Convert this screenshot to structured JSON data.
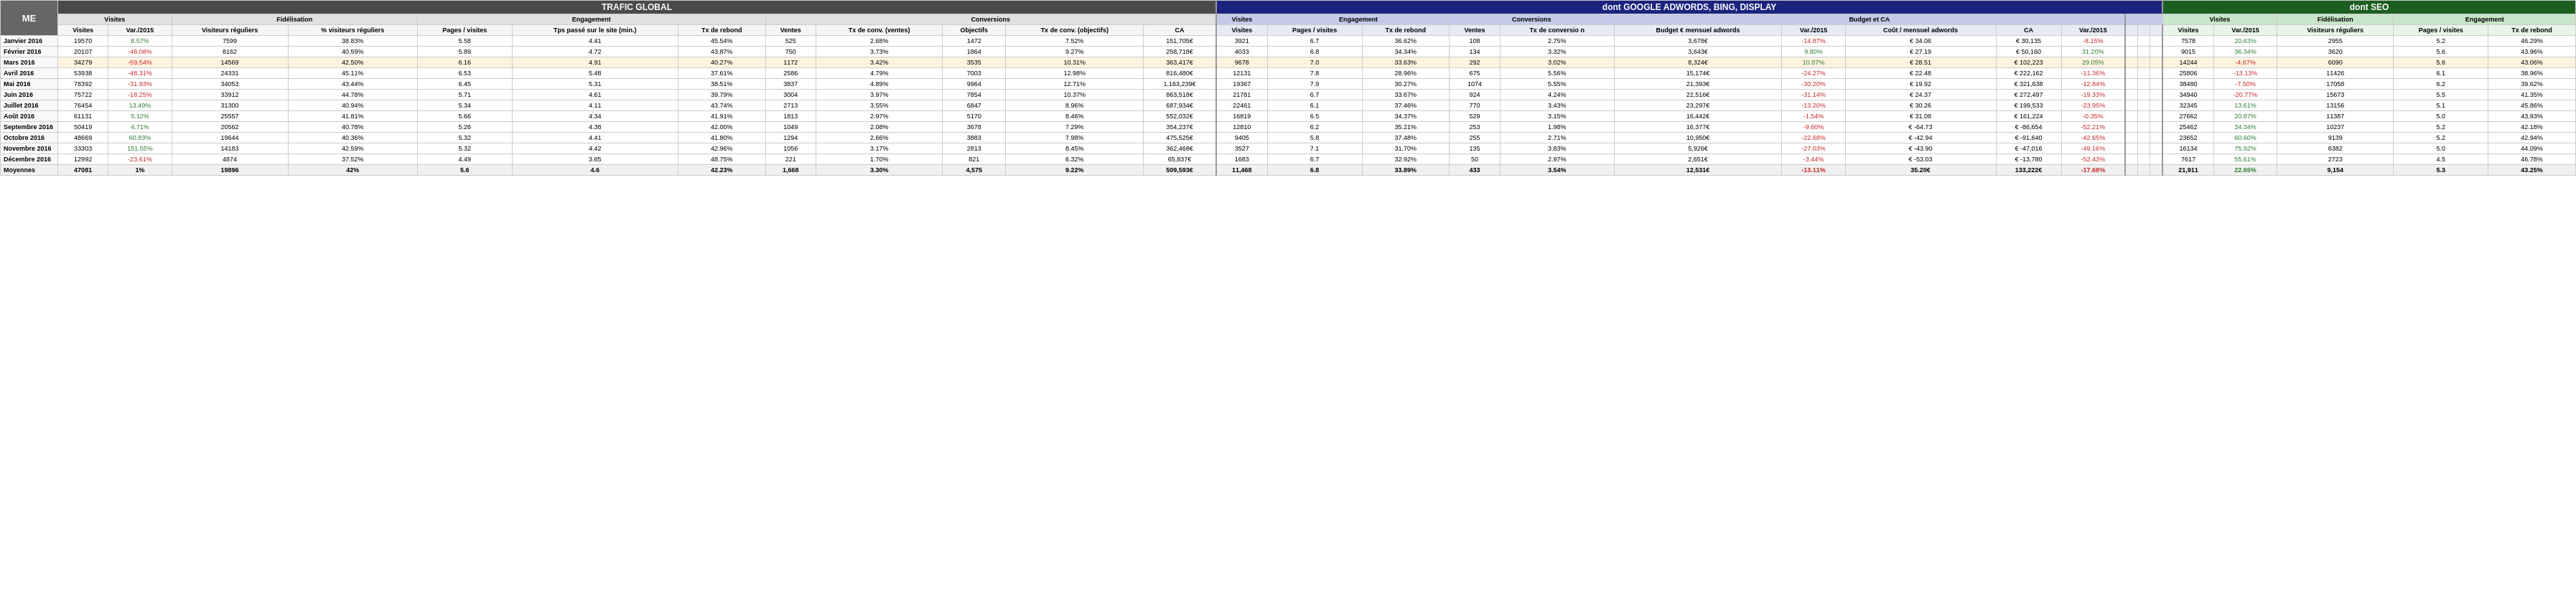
{
  "headers": {
    "me": "ME",
    "trafic_global": "TRAFIC GLOBAL",
    "adwords": "dont GOOGLE ADWORDS, BING, DISPLAY",
    "seo": "dont SEO",
    "visites": "Visites",
    "fidelisation": "Fidélisation",
    "engagement": "Engagement",
    "conversions": "Conversions",
    "budget_ca": "Budget et CA",
    "visites_col": "Visites"
  },
  "col_headers": {
    "visites": "Visites",
    "var2015": "Var./2015",
    "visiteurs_reguliers": "Visiteurs réguliers",
    "pct_visiteurs": "% visiteurs réguliers",
    "pages_visites": "Pages / visites",
    "tps_passe": "Tps passé sur le site (min.)",
    "tx_rebond": "Tx de rebond",
    "ventes": "Ventes",
    "tx_conv_ventes": "Tx de conv. (ventes)",
    "objectifs": "Objectifs",
    "tx_conv_obj": "Tx de conv. (objectifs)",
    "ca": "CA",
    "visites2": "Visites",
    "pages_visites2": "Pages / visites",
    "tx_rebond2": "Tx de rebond",
    "ventes2": "Ventes",
    "tx_conversion": "Tx de conversio n",
    "budget_adwords": "Budget € mensuel adwords",
    "var2015_2": "Var./2015",
    "cout_mensuel": "Coût / mensuel adwords",
    "ca2": "CA",
    "var2015_3": "Var./2015",
    "visites3": "Visites",
    "var2015_4": "Var./2015",
    "visiteurs_reg3": "Visiteurs réguliers",
    "pages_visites3": "Pages / visites",
    "tx_rebond3": "Tx de rebond"
  },
  "rows": [
    {
      "label": "Janvier 2016",
      "visites": "19570",
      "var2015": "8.57%",
      "var2015_class": "pos",
      "visiteurs_reg": "7599",
      "pct_visiteurs": "38.83%",
      "pages_visites": "5.58",
      "tps_passe": "4.41",
      "tx_rebond": "45.54%",
      "ventes": "525",
      "tx_conv_ventes": "2.68%",
      "objectifs": "1472",
      "tx_conv_obj": "7.52%",
      "ca": "151,705€",
      "adw_visites": "3921",
      "adw_pages": "6.7",
      "adw_rebond": "36.62%",
      "adw_ventes": "108",
      "adw_tx_conv": "2.75%",
      "adw_budget": "3,678€",
      "adw_var": "-14.87%",
      "adw_var_class": "neg",
      "adw_cout": "€ 34.06",
      "adw_ca": "€ 30,135",
      "adw_var2": "-8.15%",
      "adw_var2_class": "neg",
      "seo_visites": "7578",
      "seo_var": "20.63%",
      "seo_var_class": "pos",
      "seo_visiteurs": "2955",
      "seo_pages": "5.2",
      "seo_rebond": "46.29%"
    },
    {
      "label": "Février 2016",
      "visites": "20107",
      "var2015": "-48.08%",
      "var2015_class": "neg",
      "visiteurs_reg": "8162",
      "pct_visiteurs": "40.59%",
      "pages_visites": "5.89",
      "tps_passe": "4.72",
      "tx_rebond": "43.87%",
      "ventes": "750",
      "tx_conv_ventes": "3.73%",
      "objectifs": "1864",
      "tx_conv_obj": "9.27%",
      "ca": "258,718€",
      "adw_visites": "4033",
      "adw_pages": "6.8",
      "adw_rebond": "34.34%",
      "adw_ventes": "134",
      "adw_tx_conv": "3.32%",
      "adw_budget": "3,643€",
      "adw_var": "9.80%",
      "adw_var_class": "pos",
      "adw_cout": "€ 27.19",
      "adw_ca": "€ 50,160",
      "adw_var2": "31.20%",
      "adw_var2_class": "pos",
      "seo_visites": "9015",
      "seo_var": "36.34%",
      "seo_var_class": "pos",
      "seo_visiteurs": "3620",
      "seo_pages": "5.6",
      "seo_rebond": "43.96%"
    },
    {
      "label": "Mars 2016",
      "highlight": true,
      "visites": "34279",
      "var2015": "-59.54%",
      "var2015_class": "neg",
      "visiteurs_reg": "14569",
      "pct_visiteurs": "42.50%",
      "pages_visites": "6.16",
      "tps_passe": "4.91",
      "tx_rebond": "40.27%",
      "ventes": "1172",
      "tx_conv_ventes": "3.42%",
      "objectifs": "3535",
      "tx_conv_obj": "10.31%",
      "ca": "363,417€",
      "adw_visites": "9678",
      "adw_pages": "7.0",
      "adw_rebond": "33.63%",
      "adw_ventes": "292",
      "adw_tx_conv": "3.02%",
      "adw_budget": "8,324€",
      "adw_var": "10.87%",
      "adw_var_class": "pos",
      "adw_cout": "€ 28.51",
      "adw_ca": "€ 102,223",
      "adw_var2": "29.05%",
      "adw_var2_class": "pos",
      "seo_visites": "14244",
      "seo_var": "-4.67%",
      "seo_var_class": "neg",
      "seo_visiteurs": "6090",
      "seo_pages": "5.6",
      "seo_rebond": "43.06%"
    },
    {
      "label": "Avril 2016",
      "visites": "53938",
      "var2015": "-48.31%",
      "var2015_class": "neg",
      "visiteurs_reg": "24331",
      "pct_visiteurs": "45.11%",
      "pages_visites": "6.53",
      "tps_passe": "5.48",
      "tx_rebond": "37.61%",
      "ventes": "2586",
      "tx_conv_ventes": "4.79%",
      "objectifs": "7003",
      "tx_conv_obj": "12.98%",
      "ca": "816,480€",
      "adw_visites": "12131",
      "adw_pages": "7.8",
      "adw_rebond": "28.96%",
      "adw_ventes": "675",
      "adw_tx_conv": "5.56%",
      "adw_budget": "15,174€",
      "adw_var": "-24.27%",
      "adw_var_class": "neg",
      "adw_cout": "€ 22.48",
      "adw_ca": "€ 222,162",
      "adw_var2": "-11.36%",
      "adw_var2_class": "neg",
      "seo_visites": "25806",
      "seo_var": "-13.13%",
      "seo_var_class": "neg",
      "seo_visiteurs": "11426",
      "seo_pages": "6.1",
      "seo_rebond": "38.96%"
    },
    {
      "label": "Mai 2016",
      "visites": "78392",
      "var2015": "-31.93%",
      "var2015_class": "neg",
      "visiteurs_reg": "34053",
      "pct_visiteurs": "43.44%",
      "pages_visites": "6.45",
      "tps_passe": "5.31",
      "tx_rebond": "38.51%",
      "ventes": "3837",
      "tx_conv_ventes": "4.89%",
      "objectifs": "9964",
      "tx_conv_obj": "12.71%",
      "ca": "1,163,239€",
      "adw_visites": "19367",
      "adw_pages": "7.9",
      "adw_rebond": "30.27%",
      "adw_ventes": "1074",
      "adw_tx_conv": "5.55%",
      "adw_budget": "21,393€",
      "adw_var": "-30.20%",
      "adw_var_class": "neg",
      "adw_cout": "€ 19.92",
      "adw_ca": "€ 321,638",
      "adw_var2": "-12.84%",
      "adw_var2_class": "neg",
      "seo_visites": "38480",
      "seo_var": "-7.50%",
      "seo_var_class": "neg",
      "seo_visiteurs": "17058",
      "seo_pages": "6.2",
      "seo_rebond": "39.62%"
    },
    {
      "label": "Juin 2016",
      "visites": "75722",
      "var2015": "-18.25%",
      "var2015_class": "neg",
      "visiteurs_reg": "33912",
      "pct_visiteurs": "44.78%",
      "pages_visites": "5.71",
      "tps_passe": "4.61",
      "tx_rebond": "39.79%",
      "ventes": "3004",
      "tx_conv_ventes": "3.97%",
      "objectifs": "7854",
      "tx_conv_obj": "10.37%",
      "ca": "863,518€",
      "adw_visites": "21781",
      "adw_pages": "6.7",
      "adw_rebond": "33.67%",
      "adw_ventes": "924",
      "adw_tx_conv": "4.24%",
      "adw_budget": "22,516€",
      "adw_var": "-31.14%",
      "adw_var_class": "neg",
      "adw_cout": "€ 24.37",
      "adw_ca": "€ 272,497",
      "adw_var2": "-19.33%",
      "adw_var2_class": "neg",
      "seo_visites": "34940",
      "seo_var": "-20.77%",
      "seo_var_class": "neg",
      "seo_visiteurs": "15673",
      "seo_pages": "5.5",
      "seo_rebond": "41.35%"
    },
    {
      "label": "Juillet 2016",
      "visites": "76454",
      "var2015": "13.49%",
      "var2015_class": "pos",
      "visiteurs_reg": "31300",
      "pct_visiteurs": "40.94%",
      "pages_visites": "5.34",
      "tps_passe": "4.11",
      "tx_rebond": "43.74%",
      "ventes": "2713",
      "tx_conv_ventes": "3.55%",
      "objectifs": "6847",
      "tx_conv_obj": "8.96%",
      "ca": "687,934€",
      "adw_visites": "22461",
      "adw_pages": "6.1",
      "adw_rebond": "37.46%",
      "adw_ventes": "770",
      "adw_tx_conv": "3.43%",
      "adw_budget": "23,297€",
      "adw_var": "-13.20%",
      "adw_var_class": "neg",
      "adw_cout": "€ 30.26",
      "adw_ca": "€ 199,533",
      "adw_var2": "-23.95%",
      "adw_var2_class": "neg",
      "seo_visites": "32345",
      "seo_var": "13.61%",
      "seo_var_class": "pos",
      "seo_visiteurs": "13156",
      "seo_pages": "5.1",
      "seo_rebond": "45.86%"
    },
    {
      "label": "Août 2016",
      "visites": "61131",
      "var2015": "5.12%",
      "var2015_class": "pos",
      "visiteurs_reg": "25557",
      "pct_visiteurs": "41.81%",
      "pages_visites": "5.66",
      "tps_passe": "4.34",
      "tx_rebond": "41.91%",
      "ventes": "1813",
      "tx_conv_ventes": "2.97%",
      "objectifs": "5170",
      "tx_conv_obj": "8.46%",
      "ca": "552,032€",
      "adw_visites": "16819",
      "adw_pages": "6.5",
      "adw_rebond": "34.37%",
      "adw_ventes": "529",
      "adw_tx_conv": "3.15%",
      "adw_budget": "16,442€",
      "adw_var": "-1.54%",
      "adw_var_class": "neg",
      "adw_cout": "€ 31.08",
      "adw_ca": "€ 161,224",
      "adw_var2": "-0.35%",
      "adw_var2_class": "neg",
      "seo_visites": "27662",
      "seo_var": "20.87%",
      "seo_var_class": "pos",
      "seo_visiteurs": "11387",
      "seo_pages": "5.0",
      "seo_rebond": "43.93%"
    },
    {
      "label": "Septembre 2016",
      "visites": "50419",
      "var2015": "4.71%",
      "var2015_class": "pos",
      "visiteurs_reg": "20562",
      "pct_visiteurs": "40.78%",
      "pages_visites": "5.26",
      "tps_passe": "4.38",
      "tx_rebond": "42.00%",
      "ventes": "1049",
      "tx_conv_ventes": "2.08%",
      "objectifs": "3678",
      "tx_conv_obj": "7.29%",
      "ca": "354,237€",
      "adw_visites": "12810",
      "adw_pages": "6.2",
      "adw_rebond": "35.21%",
      "adw_ventes": "253",
      "adw_tx_conv": "1.98%",
      "adw_budget": "16,377€",
      "adw_var": "-9.60%",
      "adw_var_class": "neg",
      "adw_cout": "€ -64.73",
      "adw_ca": "€ -86,654",
      "adw_var2": "-52.21%",
      "adw_var2_class": "neg",
      "seo_visites": "25462",
      "seo_var": "34.34%",
      "seo_var_class": "pos",
      "seo_visiteurs": "10237",
      "seo_pages": "5.2",
      "seo_rebond": "42.18%"
    },
    {
      "label": "Octobre 2016",
      "visites": "48669",
      "var2015": "60.83%",
      "var2015_class": "pos",
      "visiteurs_reg": "19644",
      "pct_visiteurs": "40.36%",
      "pages_visites": "5.32",
      "tps_passe": "4.41",
      "tx_rebond": "41.80%",
      "ventes": "1294",
      "tx_conv_ventes": "2.66%",
      "objectifs": "3883",
      "tx_conv_obj": "7.98%",
      "ca": "475,525€",
      "adw_visites": "9405",
      "adw_pages": "5.8",
      "adw_rebond": "37.48%",
      "adw_ventes": "255",
      "adw_tx_conv": "2.71%",
      "adw_budget": "10,950€",
      "adw_var": "-22.68%",
      "adw_var_class": "neg",
      "adw_cout": "€ -42.94",
      "adw_ca": "€ -91,640",
      "adw_var2": "-42.65%",
      "adw_var2_class": "neg",
      "seo_visites": "23652",
      "seo_var": "60.60%",
      "seo_var_class": "pos",
      "seo_visiteurs": "9139",
      "seo_pages": "5.2",
      "seo_rebond": "42.94%"
    },
    {
      "label": "Novembre 2016",
      "visites": "33303",
      "var2015": "151.55%",
      "var2015_class": "pos",
      "visiteurs_reg": "14183",
      "pct_visiteurs": "42.59%",
      "pages_visites": "5.32",
      "tps_passe": "4.42",
      "tx_rebond": "42.96%",
      "ventes": "1056",
      "tx_conv_ventes": "3.17%",
      "objectifs": "2813",
      "tx_conv_obj": "8.45%",
      "ca": "362,468€",
      "adw_visites": "3527",
      "adw_pages": "7.1",
      "adw_rebond": "31.70%",
      "adw_ventes": "135",
      "adw_tx_conv": "3.83%",
      "adw_budget": "5,926€",
      "adw_var": "-27.03%",
      "adw_var_class": "neg",
      "adw_cout": "€ -43.90",
      "adw_ca": "€ -47,016",
      "adw_var2": "-49.16%",
      "adw_var2_class": "neg",
      "seo_visites": "16134",
      "seo_var": "75.92%",
      "seo_var_class": "pos",
      "seo_visiteurs": "6382",
      "seo_pages": "5.0",
      "seo_rebond": "44.09%"
    },
    {
      "label": "Décembre 2016",
      "visites": "12992",
      "var2015": "-23.61%",
      "var2015_class": "neg",
      "visiteurs_reg": "4874",
      "pct_visiteurs": "37.52%",
      "pages_visites": "4.49",
      "tps_passe": "3.65",
      "tx_rebond": "48.75%",
      "ventes": "221",
      "tx_conv_ventes": "1.70%",
      "objectifs": "821",
      "tx_conv_obj": "6.32%",
      "ca": "65,837€",
      "adw_visites": "1683",
      "adw_pages": "6.7",
      "adw_rebond": "32.92%",
      "adw_ventes": "50",
      "adw_tx_conv": "2.97%",
      "adw_budget": "2,651€",
      "adw_var": "-3.44%",
      "adw_var_class": "neg",
      "adw_cout": "€ -53.03",
      "adw_ca": "€ -13,780",
      "adw_var2": "-52.43%",
      "adw_var2_class": "neg",
      "seo_visites": "7617",
      "seo_var": "55.61%",
      "seo_var_class": "pos",
      "seo_visiteurs": "2723",
      "seo_pages": "4.5",
      "seo_rebond": "46.78%"
    },
    {
      "label": "Moyennes",
      "is_avg": true,
      "visites": "47081",
      "var2015": "1%",
      "var2015_class": "",
      "visiteurs_reg": "19896",
      "pct_visiteurs": "42%",
      "pages_visites": "5.6",
      "tps_passe": "4.6",
      "tx_rebond": "42.23%",
      "ventes": "1,668",
      "tx_conv_ventes": "3.30%",
      "objectifs": "4,575",
      "tx_conv_obj": "9.22%",
      "ca": "509,593€",
      "adw_visites": "11,468",
      "adw_pages": "6.8",
      "adw_rebond": "33.89%",
      "adw_ventes": "433",
      "adw_tx_conv": "3.54%",
      "adw_budget": "12,531€",
      "adw_var": "-13.11%",
      "adw_var_class": "neg",
      "adw_cout": "35.20€",
      "adw_ca": "133,222€",
      "adw_var2": "-17.68%",
      "adw_var2_class": "neg",
      "seo_visites": "21,911",
      "seo_var": "22.65%",
      "seo_var_class": "pos",
      "seo_visiteurs": "9,154",
      "seo_pages": "5.3",
      "seo_rebond": "43.25%"
    }
  ]
}
